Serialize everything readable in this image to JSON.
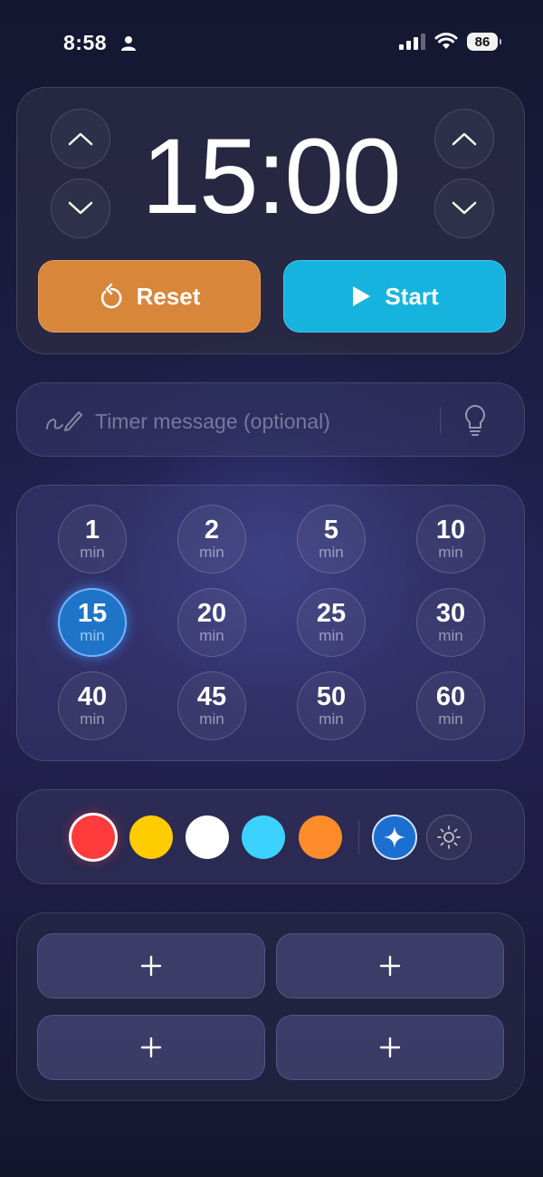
{
  "status_bar": {
    "time": "8:58",
    "battery": "86"
  },
  "timer": {
    "display": "15:00",
    "reset_label": "Reset",
    "start_label": "Start"
  },
  "message": {
    "placeholder": "Timer message (optional)"
  },
  "presets": [
    {
      "value": "1",
      "unit": "min",
      "selected": false
    },
    {
      "value": "2",
      "unit": "min",
      "selected": false
    },
    {
      "value": "5",
      "unit": "min",
      "selected": false
    },
    {
      "value": "10",
      "unit": "min",
      "selected": false
    },
    {
      "value": "15",
      "unit": "min",
      "selected": true
    },
    {
      "value": "20",
      "unit": "min",
      "selected": false
    },
    {
      "value": "25",
      "unit": "min",
      "selected": false
    },
    {
      "value": "30",
      "unit": "min",
      "selected": false
    },
    {
      "value": "40",
      "unit": "min",
      "selected": false
    },
    {
      "value": "45",
      "unit": "min",
      "selected": false
    },
    {
      "value": "50",
      "unit": "min",
      "selected": false
    },
    {
      "value": "60",
      "unit": "min",
      "selected": false
    }
  ],
  "colors": [
    {
      "name": "red",
      "hex": "#ff3b3b",
      "selected": true
    },
    {
      "name": "yellow",
      "hex": "#ffcc00",
      "selected": false
    },
    {
      "name": "white",
      "hex": "#ffffff",
      "selected": false
    },
    {
      "name": "cyan",
      "hex": "#3cd2ff",
      "selected": false
    },
    {
      "name": "orange",
      "hex": "#ff8c2a",
      "selected": false
    }
  ],
  "modes": {
    "sparkle_icon": "sparkle-icon",
    "sun_icon": "sun-icon"
  },
  "slots": [
    "+",
    "+",
    "+",
    "+"
  ],
  "theme": {
    "reset_color": "#d8863a",
    "start_color": "#16b3de",
    "selected_preset": "#1f74c8"
  }
}
